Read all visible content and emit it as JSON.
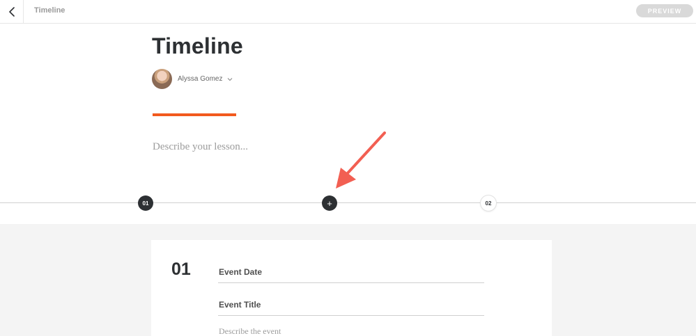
{
  "topbar": {
    "back_icon": "chevron-left-icon",
    "title": "Timeline",
    "preview_label": "PREVIEW"
  },
  "header": {
    "title": "Timeline",
    "author_name": "Alyssa Gomez",
    "author_dropdown_icon": "chevron-down-icon",
    "accent_color": "#f25a1e",
    "description_placeholder": "Describe your lesson..."
  },
  "timeline": {
    "nodes": [
      {
        "label": "01",
        "state": "active"
      },
      {
        "label": "+",
        "type": "add"
      },
      {
        "label": "02",
        "state": "inactive"
      }
    ],
    "annotation_arrow_color": "#f25f52"
  },
  "event_card": {
    "number": "01",
    "date_placeholder": "Event Date",
    "title_placeholder": "Event Title",
    "description_placeholder": "Describe the event"
  }
}
